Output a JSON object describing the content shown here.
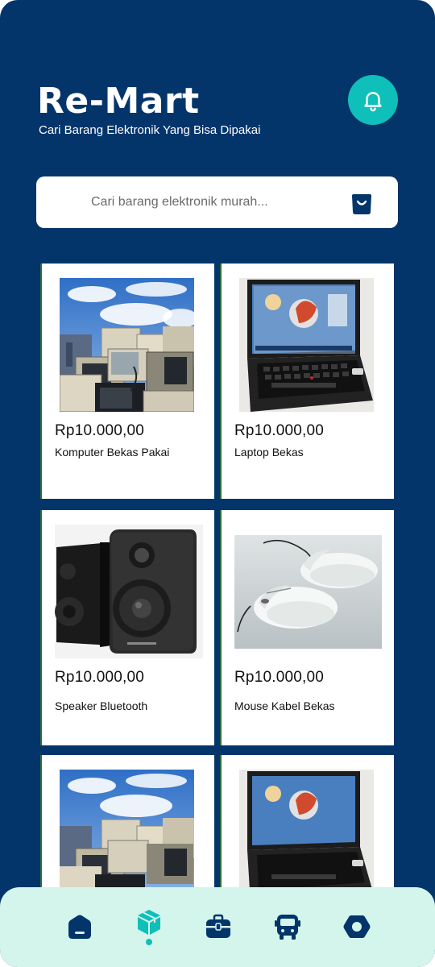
{
  "header": {
    "title": "Re-Mart",
    "subtitle": "Cari Barang Elektronik Yang Bisa Dipakai",
    "notification_icon": "bell-icon"
  },
  "search": {
    "placeholder": "Cari barang elektronik murah...",
    "action_icon": "shopping-bag-icon"
  },
  "products": [
    {
      "price": "Rp10.000,00",
      "name": "Komputer Bekas Pakai",
      "image": "pile-of-old-computers"
    },
    {
      "price": "Rp10.000,00",
      "name": "Laptop Bekas",
      "image": "used-laptop"
    },
    {
      "price": "Rp10.000,00",
      "name": "Speaker Bluetooth",
      "image": "pair-of-speakers"
    },
    {
      "price": "Rp10.000,00",
      "name": "Mouse Kabel Bekas",
      "image": "wired-mice"
    },
    {
      "price": "",
      "name": "",
      "image": "pile-of-old-computers"
    },
    {
      "price": "",
      "name": "",
      "image": "used-laptop"
    }
  ],
  "bottom_nav": {
    "items": [
      "home-icon",
      "package-icon",
      "briefcase-icon",
      "bus-icon",
      "settings-icon"
    ],
    "active": "package-icon"
  },
  "colors": {
    "background": "#03356b",
    "accent": "#0fbfb9",
    "nav_background": "#d4f5ec",
    "icon_dark": "#03356b"
  }
}
